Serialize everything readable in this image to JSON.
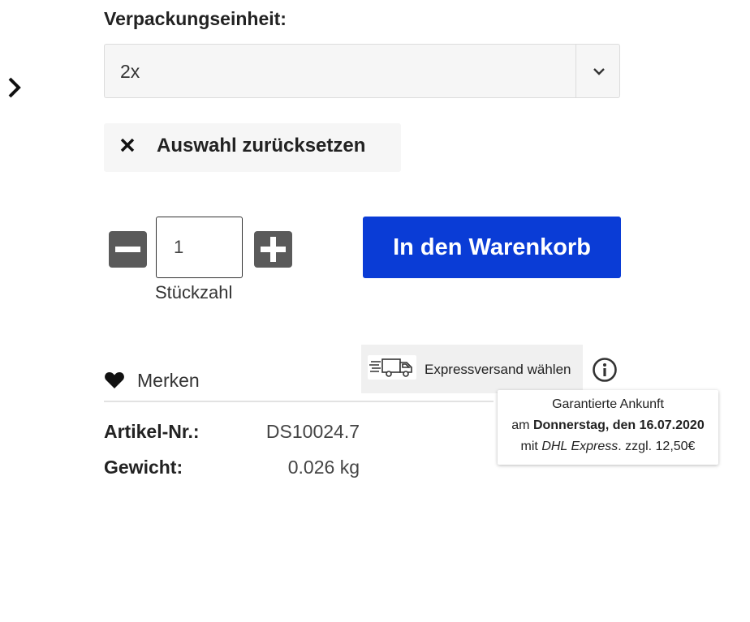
{
  "variant": {
    "label": "Verpackungseinheit:",
    "selected_value": "2x"
  },
  "reset": {
    "label": "Auswahl zurücksetzen"
  },
  "quantity": {
    "value": "1",
    "label": "Stückzahl"
  },
  "cart": {
    "button_label": "In den Warenkorb",
    "accent_color": "#0a3cd6"
  },
  "wishlist": {
    "label": "Merken"
  },
  "shipping": {
    "express_label": "Expressversand wählen",
    "tooltip": {
      "line1": "Garantierte Ankunft",
      "line2_prefix": "am",
      "line2_date": "Donnerstag, den 16.07.2020",
      "line3_prefix": "mit",
      "line3_carrier": "DHL Express",
      "line3_suffix": ". zzgl. 12,50€"
    }
  },
  "specs": {
    "article_label": "Artikel-Nr.:",
    "article_value": "DS10024.7",
    "weight_label": "Gewicht:",
    "weight_value": "0.026 kg"
  },
  "icons": [
    "chevron-right-icon",
    "chevron-down-icon",
    "close-icon",
    "minus-icon",
    "plus-icon",
    "heart-icon",
    "truck-icon",
    "info-icon"
  ]
}
